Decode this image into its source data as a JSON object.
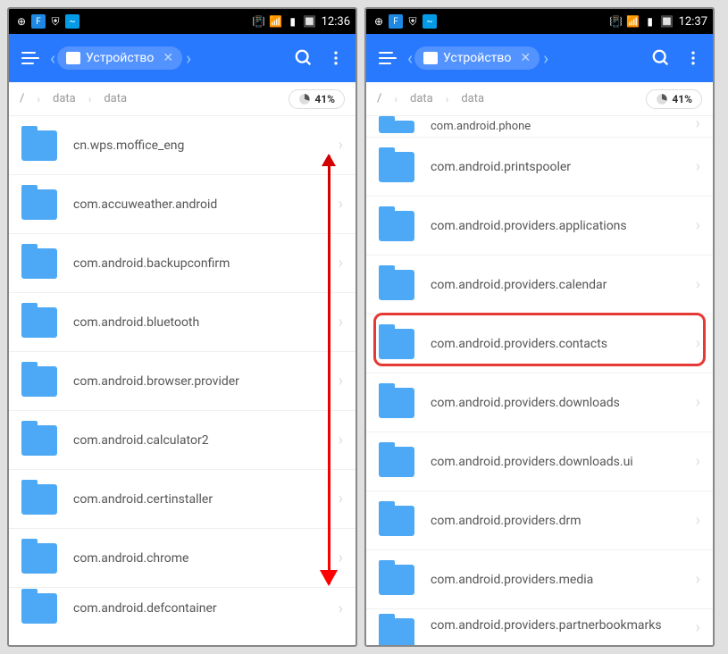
{
  "left": {
    "status": {
      "time": "12:36"
    },
    "toolbar": {
      "device_label": "Устройство"
    },
    "breadcrumb": {
      "root": "/",
      "seg1": "data",
      "seg2": "data",
      "storage": "41%"
    },
    "files": [
      "cn.wps.moffice_eng",
      "com.accuweather.android",
      "com.android.backupconfirm",
      "com.android.bluetooth",
      "com.android.browser.provider",
      "com.android.calculator2",
      "com.android.certinstaller",
      "com.android.chrome",
      "com.android.defcontainer"
    ]
  },
  "right": {
    "status": {
      "time": "12:37"
    },
    "toolbar": {
      "device_label": "Устройство"
    },
    "breadcrumb": {
      "root": "/",
      "seg1": "data",
      "seg2": "data",
      "storage": "41%"
    },
    "file_top": "com.android.phone",
    "files": [
      "com.android.printspooler",
      "com.android.providers.applications",
      "com.android.providers.calendar",
      "com.android.providers.contacts",
      "com.android.providers.downloads",
      "com.android.providers.downloads.ui",
      "com.android.providers.drm",
      "com.android.providers.media"
    ],
    "file_bottom": "com.android.providers.partnerbookmarks",
    "highlight_index": 3
  }
}
